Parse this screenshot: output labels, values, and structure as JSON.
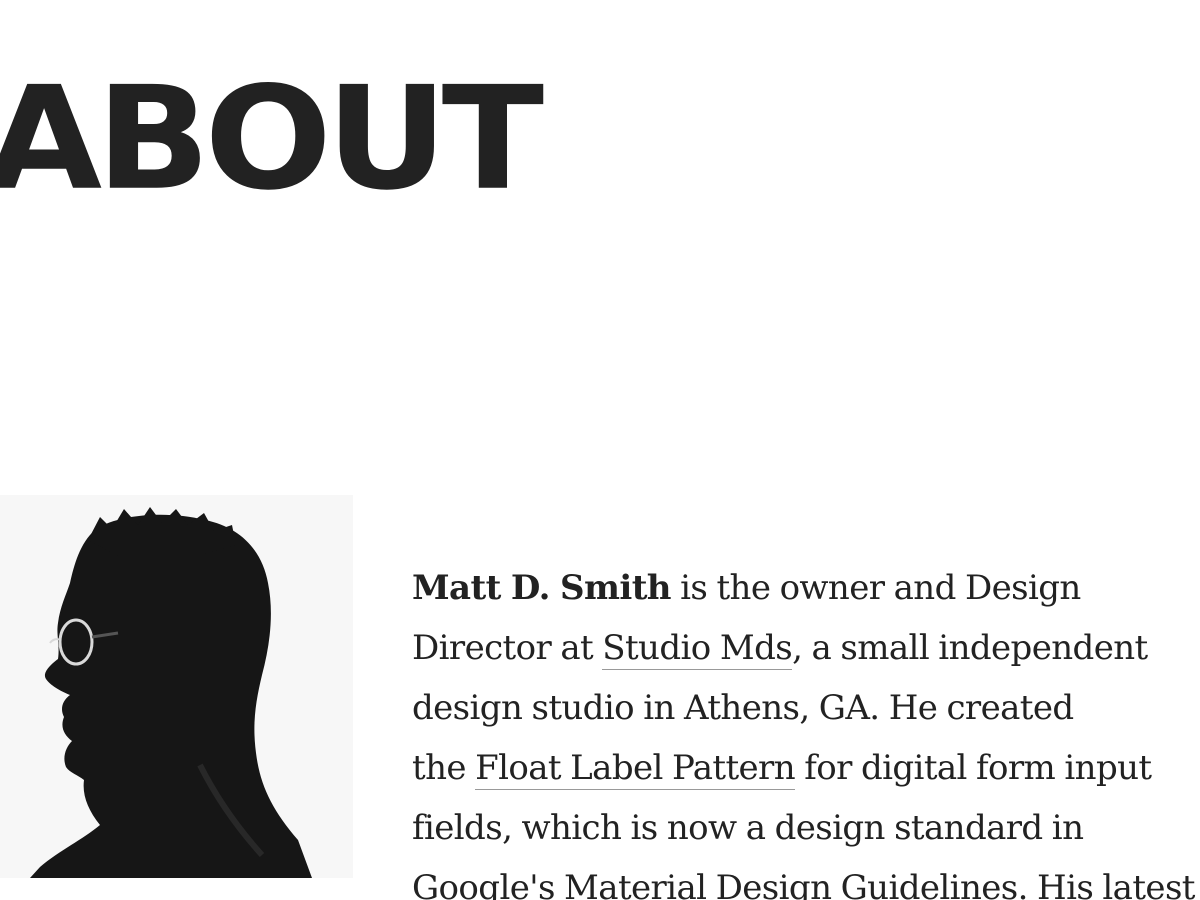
{
  "page": {
    "title": "ABOUT"
  },
  "portrait": {
    "icon": "profile-silhouette"
  },
  "bio": {
    "name": "Matt D. Smith",
    "line1_rest": " is the owner and Design",
    "line2_pre": "Director at ",
    "studio_link": "Studio Mds",
    "line2_post": ", a small independent",
    "line3": "design studio in Athens, GA. He created",
    "line4_pre": "the ",
    "pattern_link": "Float Label Pattern",
    "line4_post": " for digital form input",
    "line5": "fields, which is now a design standard in",
    "line6": "Google's Material Design Guidelines. His latest"
  },
  "colors": {
    "text": "#222222",
    "background": "#ffffff",
    "link_underline": "#999999"
  }
}
